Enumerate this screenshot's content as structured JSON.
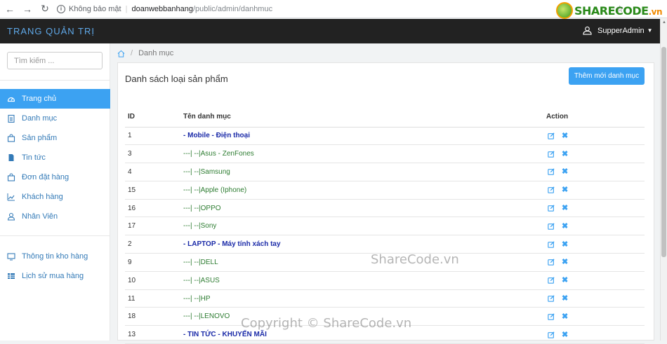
{
  "browser": {
    "insecure_label": "Không bảo mật",
    "host": "doanwebbanhang",
    "path": "/public/admin/danhmuc",
    "logo_text": "SHARECODE",
    "logo_suffix": ".vn"
  },
  "topbar": {
    "brand": "TRANG QUẢN TRỊ",
    "user": "SupperAdmin"
  },
  "sidebar": {
    "search_placeholder": "Tìm kiếm ...",
    "items": [
      {
        "label": "Trang chủ",
        "icon": "dashboard-icon",
        "active": true
      },
      {
        "label": "Danh mục",
        "icon": "clipboard-icon"
      },
      {
        "label": "Sản phẩm",
        "icon": "shopping-bag-icon"
      },
      {
        "label": "Tin tức",
        "icon": "file-icon"
      },
      {
        "label": "Đơn đặt hàng",
        "icon": "bag-icon"
      },
      {
        "label": "Khách hàng",
        "icon": "line-chart-icon"
      },
      {
        "label": "Nhân Viên",
        "icon": "user-icon"
      }
    ],
    "items2": [
      {
        "label": "Thông tin kho hàng",
        "icon": "monitor-icon"
      },
      {
        "label": "Lịch sử mua hàng",
        "icon": "table-icon"
      }
    ]
  },
  "breadcrumb": {
    "home_icon": "home-icon",
    "current": "Danh mục"
  },
  "panel": {
    "title": "Danh sách loại sản phẩm",
    "add_button": "Thêm mới danh mục"
  },
  "table": {
    "headers": {
      "id": "ID",
      "name": "Tên danh mục",
      "action": "Action"
    },
    "rows": [
      {
        "id": "1",
        "name": "- Mobile - Điện thoại",
        "level": "parent"
      },
      {
        "id": "3",
        "name": "---| --|Asus - ZenFones",
        "level": "child"
      },
      {
        "id": "4",
        "name": "---| --|Samsung",
        "level": "child"
      },
      {
        "id": "15",
        "name": "---| --|Apple (Iphone)",
        "level": "child"
      },
      {
        "id": "16",
        "name": "---| --|OPPO",
        "level": "child"
      },
      {
        "id": "17",
        "name": "---| --|Sony",
        "level": "child"
      },
      {
        "id": "2",
        "name": "- LAPTOP - Máy tính xách tay",
        "level": "parent"
      },
      {
        "id": "9",
        "name": "---| --|DELL",
        "level": "child"
      },
      {
        "id": "10",
        "name": "---| --|ASUS",
        "level": "child"
      },
      {
        "id": "11",
        "name": "---| --|HP",
        "level": "child"
      },
      {
        "id": "18",
        "name": "---| --|LENOVO",
        "level": "child"
      },
      {
        "id": "13",
        "name": "- TIN TỨC - KHUYẾN MÃI",
        "level": "parent"
      }
    ]
  },
  "watermarks": {
    "center": "ShareCode.vn",
    "bottom": "Copyright © ShareCode.vn"
  },
  "colors": {
    "accent": "#3ca2f2",
    "topbar": "#222222",
    "parent_text": "#1a2aa8",
    "child_text": "#2e7d32"
  }
}
